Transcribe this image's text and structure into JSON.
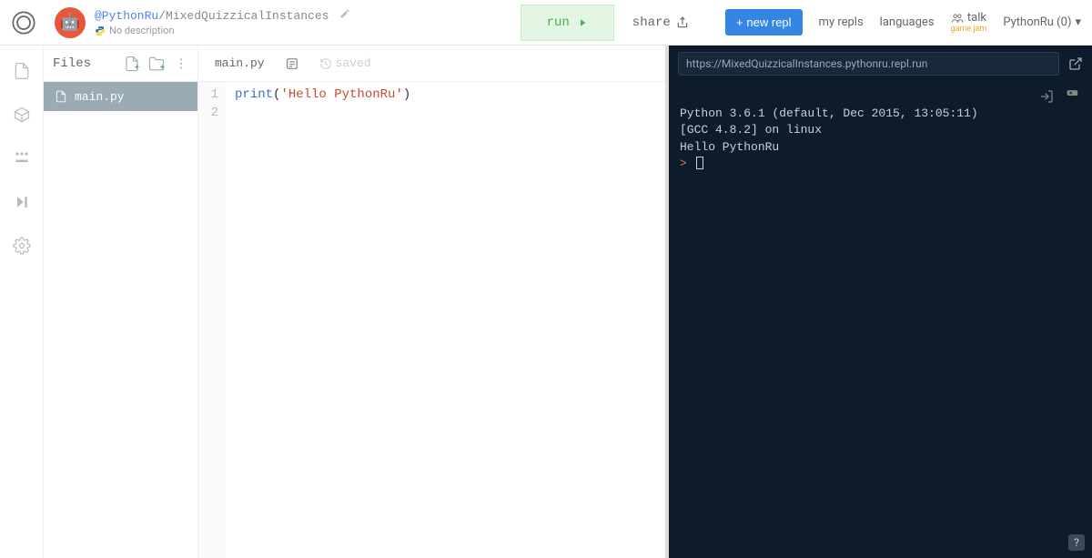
{
  "header": {
    "owner": "@PythonRu",
    "separator": "/",
    "project": "MixedQuizzicalInstances",
    "description": "No description",
    "run_label": "run",
    "share_label": "share",
    "newrepl_label": "new repl",
    "nav_myrepls": "my repls",
    "nav_languages": "languages",
    "nav_talk": "talk",
    "nav_talk_sub": "game jam",
    "user_label": "PythonRu (0)"
  },
  "files": {
    "title": "Files",
    "items": [
      {
        "name": "main.py",
        "active": true
      }
    ]
  },
  "editor": {
    "tab": "main.py",
    "saved_label": "saved",
    "lines": [
      {
        "n": "1",
        "fn": "print",
        "open": "(",
        "str": "'Hello PythonRu'",
        "close": ")"
      },
      {
        "n": "2",
        "fn": "",
        "open": "",
        "str": "",
        "close": ""
      }
    ]
  },
  "console": {
    "url": "https://MixedQuizzicalInstances.pythonru.repl.run",
    "line1": "Python 3.6.1 (default, Dec 2015, 13:05:11)",
    "line2": "[GCC 4.8.2] on linux",
    "line3": "Hello PythonRu",
    "prompt": ">",
    "help": "?"
  }
}
